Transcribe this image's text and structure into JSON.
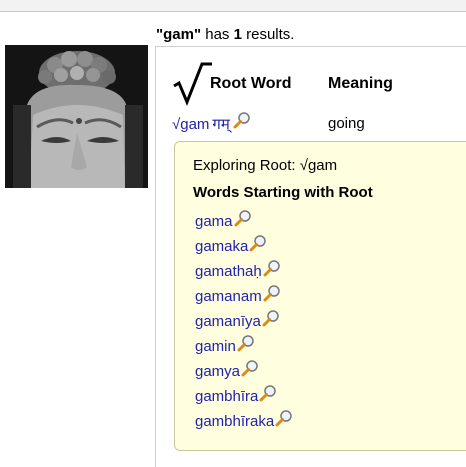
{
  "search": {
    "query": "\"gam\"",
    "text_has": " has ",
    "count": "1",
    "text_results": " results."
  },
  "table": {
    "root_header": "Root Word",
    "meaning_header": "Meaning",
    "rows": [
      {
        "root_symbol": "√gam",
        "devanagari": "गम्",
        "meaning": "going"
      }
    ]
  },
  "explore": {
    "title": "Exploring Root: √gam",
    "heading": "Words Starting with Root",
    "words": [
      "gama",
      "gamaka",
      "gamathaḥ",
      "gamanam",
      "gamanīya",
      "gamin",
      "gamya",
      "gambhīra",
      "gambhīraka"
    ]
  },
  "icons": {
    "search": "magnifier-icon",
    "root": "radical-sign-icon"
  },
  "colors": {
    "link": "#2222aa",
    "explore_bg": "#ffffe0",
    "magnifier_handle": "#d98b1a"
  }
}
